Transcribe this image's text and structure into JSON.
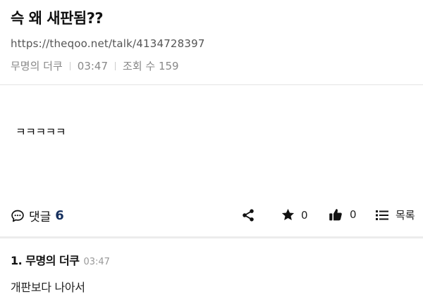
{
  "post": {
    "title": "슥 왜 새판됨??",
    "url": "https://theqoo.net/talk/4134728397",
    "author": "무명의 더쿠",
    "time": "03:47",
    "views_label": "조회 수 159",
    "body": "ㅋㅋㅋㅋㅋ"
  },
  "actions": {
    "comments_label": "댓글",
    "comments_count": "6",
    "star_count": "0",
    "like_count": "0",
    "list_label": "목록"
  },
  "comments": [
    {
      "index_author": "1. 무명의 더쿠",
      "time": "03:47",
      "text": "개판보다 나아서"
    }
  ],
  "icons": {
    "comment": "speech-bubble-icon",
    "share": "share-icon",
    "star": "star-icon",
    "like": "thumbs-up-icon",
    "list": "list-icon"
  }
}
